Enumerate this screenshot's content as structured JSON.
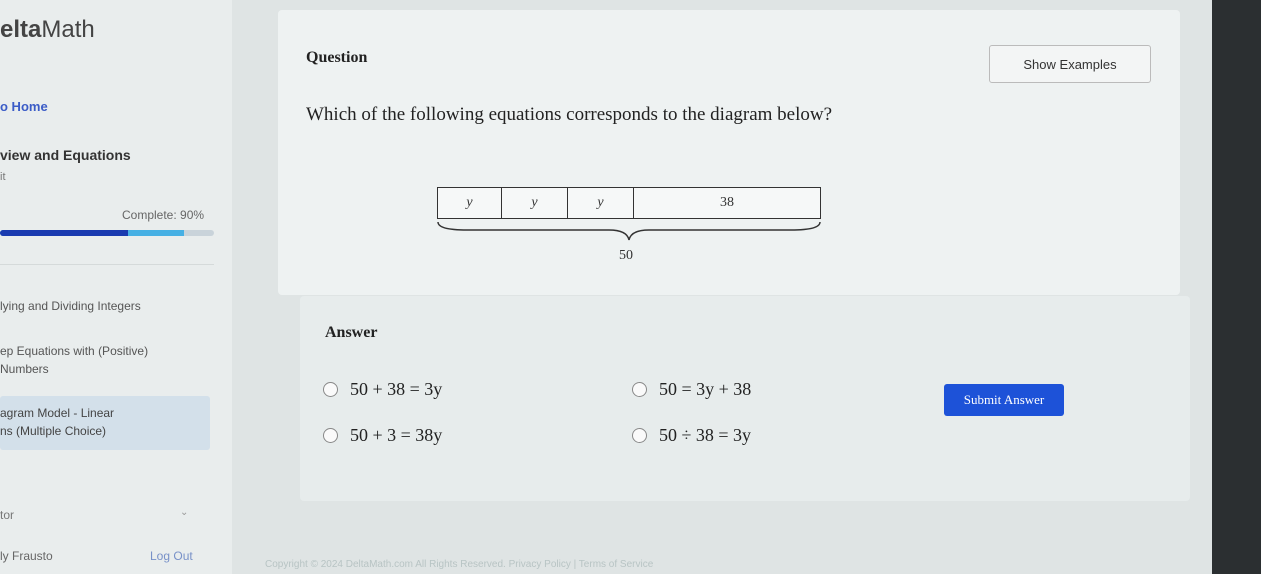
{
  "sidebar": {
    "logo_bold": "elta",
    "logo_rest": "Math",
    "home_link": "o Home",
    "unit_title": "view and Equations",
    "unit_sub": "it",
    "complete_label": "Complete: 90%",
    "progress": {
      "mastered_percent": 60,
      "complete_percent": 90
    },
    "items": [
      "lying and Dividing Integers",
      "ep Equations with (Positive)",
      "Numbers"
    ],
    "selected_item": [
      "agram Model - Linear",
      "ns (Multiple Choice)"
    ],
    "tutor": "tor",
    "user": "ly Frausto",
    "logout": "Log Out"
  },
  "question": {
    "label": "Question",
    "show_examples": "Show Examples",
    "text": "Which of the following equations corresponds to the diagram below?",
    "diagram": {
      "cells": [
        "y",
        "y",
        "y",
        "38"
      ],
      "total": "50"
    }
  },
  "answer": {
    "label": "Answer",
    "options": [
      "50 + 38 = 3y",
      "50 = 3y + 38",
      "50 + 3 = 38y",
      "50 ÷ 38 = 3y"
    ],
    "submit": "Submit Answer"
  },
  "footer": "Copyright © 2024 DeltaMath.com All Rights Reserved.     Privacy Policy | Terms of Service",
  "colors": {
    "accent": "#1d52d8",
    "progress_dark": "#1a3bb0",
    "progress_light": "#46b0e4"
  }
}
